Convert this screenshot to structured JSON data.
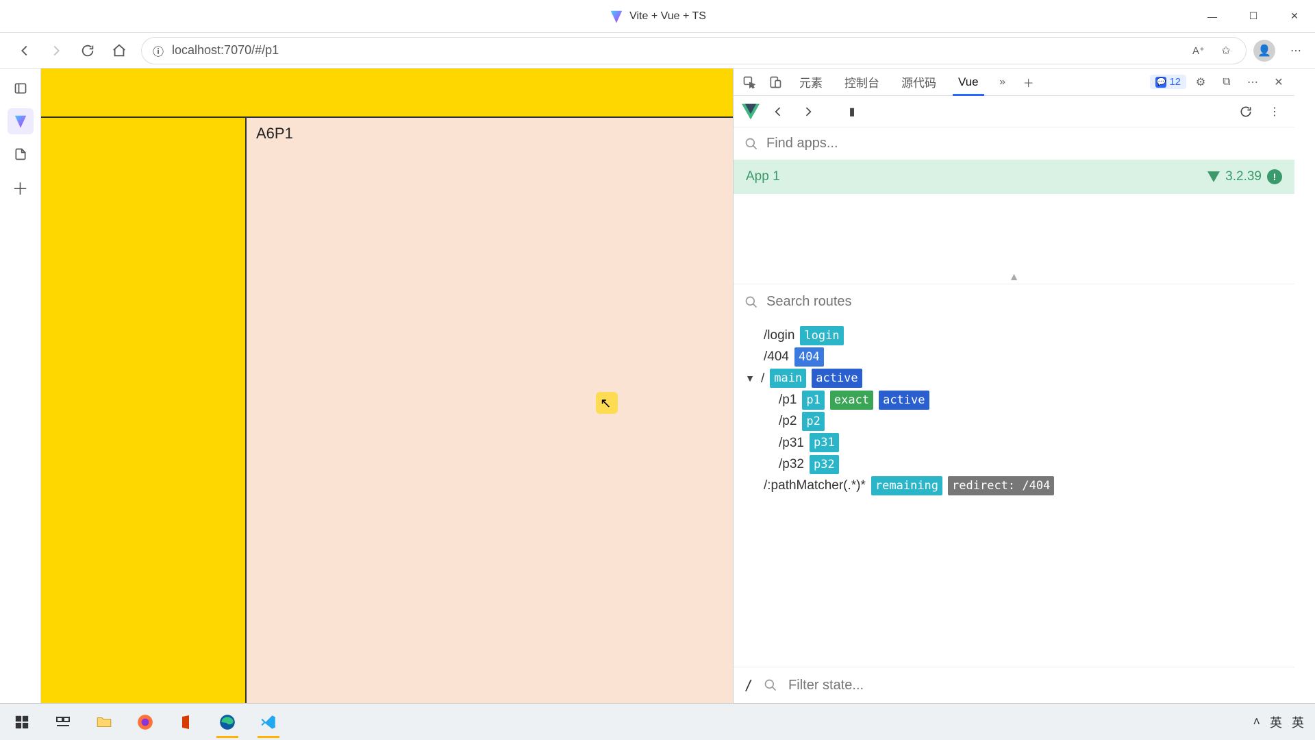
{
  "window": {
    "title": "Vite + Vue + TS"
  },
  "toolbar": {
    "url": "localhost:7070/#/p1",
    "read_aloud": "A⁺"
  },
  "page": {
    "content_heading": "A6P1"
  },
  "devtools": {
    "tabs": {
      "elements": "元素",
      "console": "控制台",
      "sources": "源代码",
      "vue": "Vue"
    },
    "issues_count": "12",
    "find_apps_placeholder": "Find apps...",
    "app_name": "App 1",
    "vue_version": "3.2.39",
    "search_routes_placeholder": "Search routes",
    "filter_state_placeholder": "Filter state...",
    "routes": [
      {
        "path": "/login",
        "tags": [
          {
            "t": "login",
            "c": "cyan"
          }
        ],
        "indent": 1
      },
      {
        "path": "/404",
        "tags": [
          {
            "t": "404",
            "c": "blue"
          }
        ],
        "indent": 1
      },
      {
        "path": "/",
        "tags": [
          {
            "t": "main",
            "c": "cyan"
          },
          {
            "t": "active",
            "c": "dblue"
          }
        ],
        "indent": 0,
        "tri": true
      },
      {
        "path": "/p1",
        "tags": [
          {
            "t": "p1",
            "c": "cyan"
          },
          {
            "t": "exact",
            "c": "green"
          },
          {
            "t": "active",
            "c": "dblue"
          }
        ],
        "indent": 2
      },
      {
        "path": "/p2",
        "tags": [
          {
            "t": "p2",
            "c": "cyan"
          }
        ],
        "indent": 2
      },
      {
        "path": "/p31",
        "tags": [
          {
            "t": "p31",
            "c": "cyan"
          }
        ],
        "indent": 2
      },
      {
        "path": "/p32",
        "tags": [
          {
            "t": "p32",
            "c": "cyan"
          }
        ],
        "indent": 2
      },
      {
        "path": "/:pathMatcher(.*)*",
        "tags": [
          {
            "t": "remaining",
            "c": "cyan"
          },
          {
            "t": "redirect: /404",
            "c": "grey"
          }
        ],
        "indent": 1
      }
    ],
    "state_path": "/"
  },
  "tray": {
    "ime1": "英",
    "ime2": "英"
  }
}
